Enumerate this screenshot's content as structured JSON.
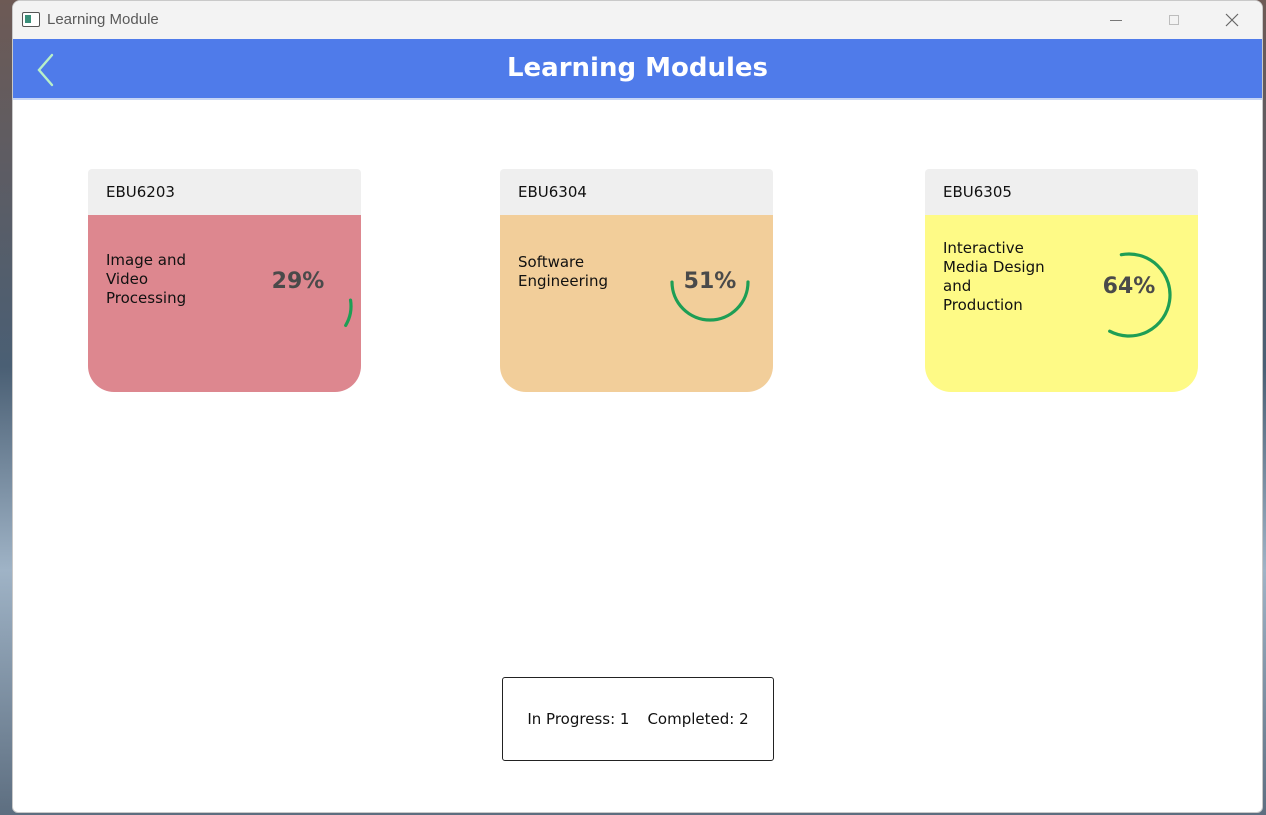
{
  "window": {
    "title": "Learning Module"
  },
  "header": {
    "title": "Learning Modules",
    "background": "#4f7bea",
    "back_icon": "chevron-left-icon"
  },
  "modules": [
    {
      "code": "EBU6203",
      "name": "Image  and\nVideo\nProcessing",
      "progress_label": "29%",
      "progress": 0.29,
      "color": "#dd878f"
    },
    {
      "code": "EBU6304",
      "name": "Software\nEngineering",
      "progress_label": "51%",
      "progress": 0.51,
      "color": "#f2ce9a"
    },
    {
      "code": "EBU6305",
      "name": "Interactive\nMedia Design\nand\nProduction",
      "progress_label": "64%",
      "progress": 0.64,
      "color": "#fefa86"
    }
  ],
  "progress_ring_color": "#1e9e55",
  "summary": {
    "in_progress": "In Progress: 1",
    "completed": "Completed: 2"
  }
}
